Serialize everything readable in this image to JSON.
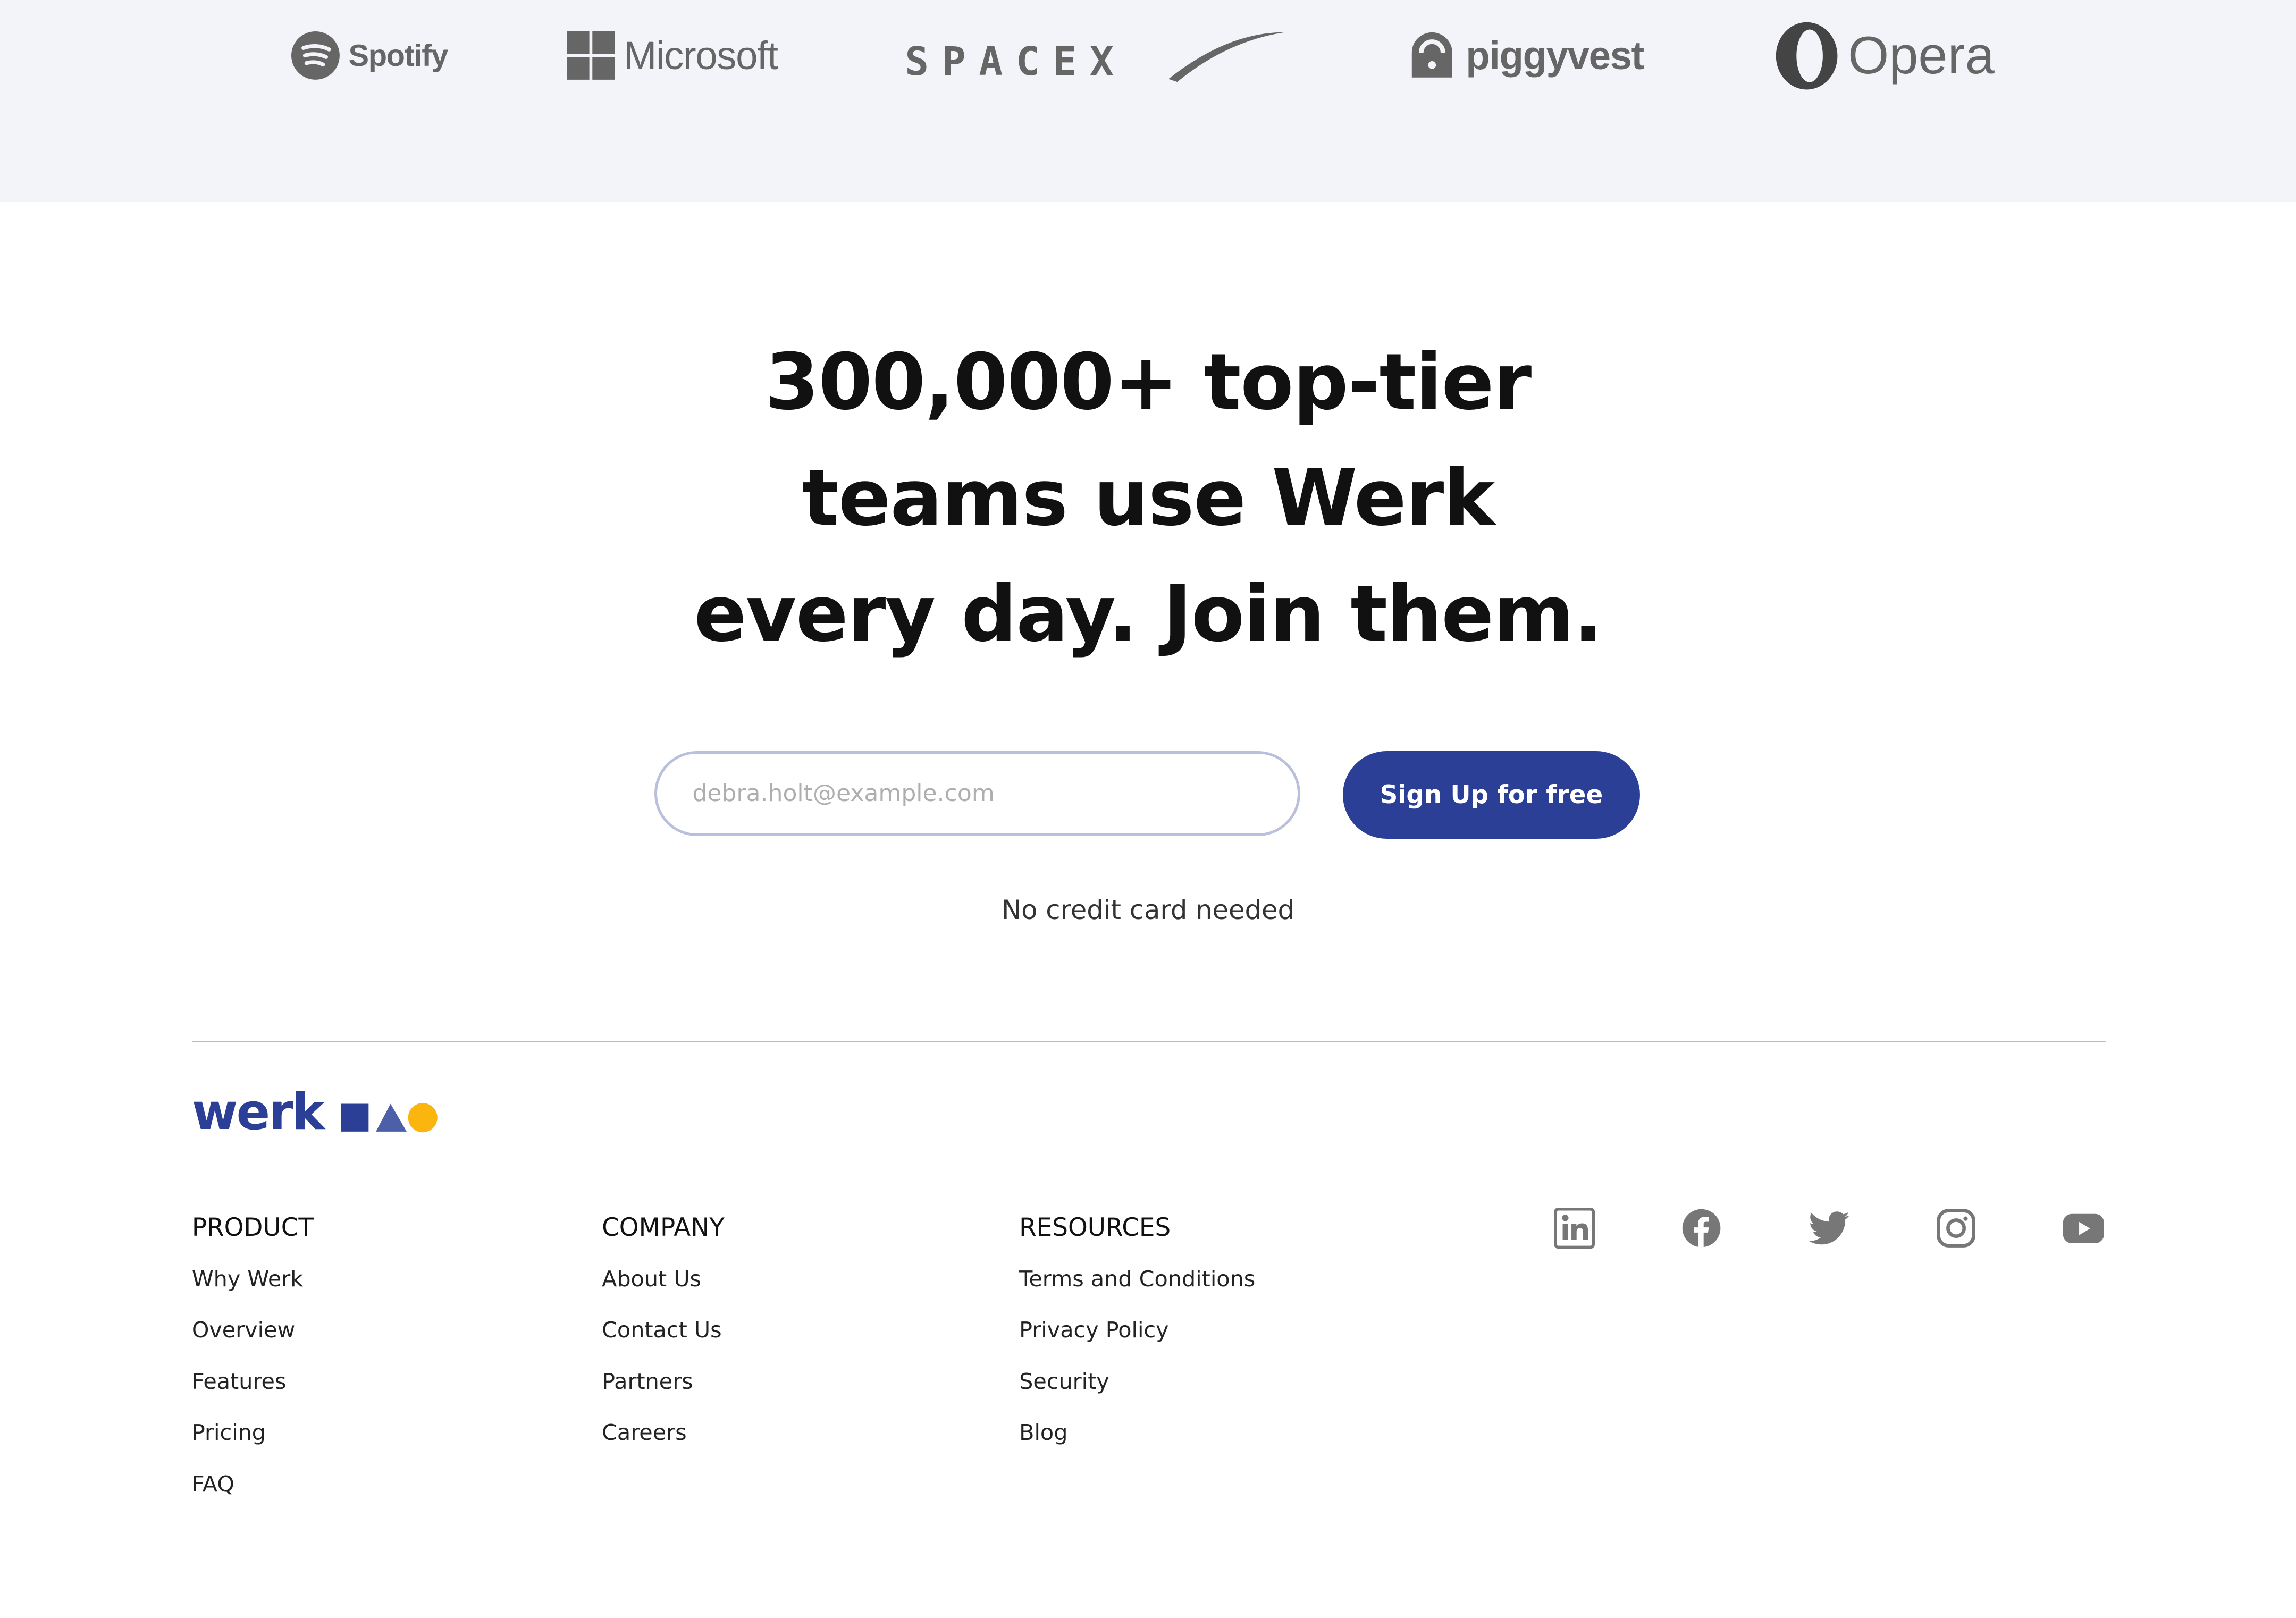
{
  "logos": [
    {
      "name": "Spotify",
      "icon": "spotify-icon"
    },
    {
      "name": "Microsoft",
      "icon": "windows-icon"
    },
    {
      "name": "SPACEX",
      "icon": "spacex-swoosh"
    },
    {
      "name": "piggyvest",
      "icon": "lock-icon"
    },
    {
      "name": "Opera",
      "icon": "opera-icon"
    }
  ],
  "hero": {
    "line1": "300,000+ top-tier",
    "line2": "teams use Werk",
    "line3": "every day. Join them."
  },
  "signup": {
    "email_placeholder": "debra.holt@example.com",
    "button_label": "Sign Up for free",
    "note": "No credit card needed"
  },
  "footer": {
    "brand": "werk",
    "colors": {
      "brand": "#2b3f96",
      "triangle": "#4d5fa8",
      "circle": "#fbb50f"
    },
    "columns": [
      {
        "title": "PRODUCT",
        "links": [
          "Why Werk",
          "Overview",
          "Features",
          "Pricing",
          "FAQ"
        ]
      },
      {
        "title": "COMPANY",
        "links": [
          "About Us",
          "Contact Us",
          "Partners",
          "Careers"
        ]
      },
      {
        "title": "RESOURCES",
        "links": [
          "Terms and Conditions",
          "Privacy Policy",
          "Security",
          "Blog"
        ]
      }
    ],
    "social": [
      "linkedin-icon",
      "facebook-icon",
      "twitter-icon",
      "instagram-icon",
      "youtube-icon"
    ]
  }
}
